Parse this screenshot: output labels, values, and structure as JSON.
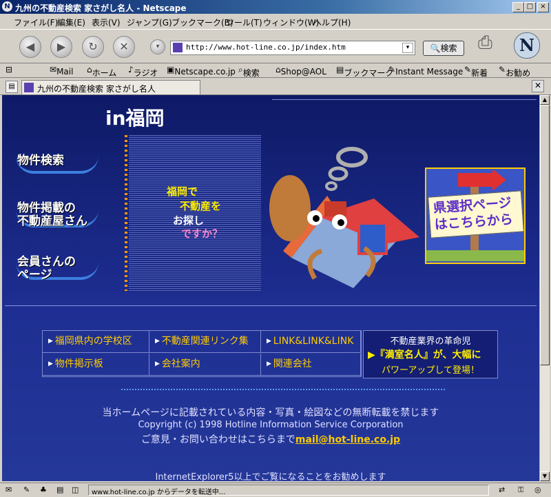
{
  "window": {
    "title": "九州の不動産検索 家さがし名人 - Netscape",
    "minimize": "_",
    "maximize": "□",
    "close": "×"
  },
  "menu": [
    "ファイル(F)",
    "編集(E)",
    "表示(V)",
    "ジャンプ(G)",
    "ブックマーク(B)",
    "ツール(T)",
    "ウィンドウ(W)",
    "ヘルプ(H)"
  ],
  "nav": {
    "url": "http://www.hot-line.co.jp/index.htm",
    "search_label": "検索"
  },
  "personal_toolbar": [
    "Mail",
    "ホーム",
    "ラジオ",
    "Netscape.co.jp",
    "検索",
    "Shop@AOL",
    "ブックマーク",
    "Instant Message",
    "新着",
    "お勧め"
  ],
  "tab": {
    "label": "九州の不動産検索 家さがし名人"
  },
  "page": {
    "heading": "in福岡",
    "left_menu": [
      "物件検索",
      "物件掲載の\n不動産屋さん",
      "会員さんの\nページ"
    ],
    "slogan": [
      "福岡で",
      "不動産を",
      "お探し",
      "ですか？"
    ],
    "sign": "県選択ページはこちらから",
    "links_row1": [
      "福岡県内の学校区",
      "不動産関連リンク集",
      "LINK&LINK&LINK"
    ],
    "links_row2": [
      "物件掲示板",
      "会社案内",
      "関連会社"
    ],
    "promo": {
      "line1": "不動産業界の革命児",
      "line2": "『満室名人』が、大幅に",
      "line3": "パワーアップして登場！"
    },
    "footer": {
      "notice": "当ホームページに記載されている内容・写真・絵図などの無断転載を禁じます",
      "copyright": "Copyright (c) 1998 Hotline Information Service Corporation",
      "contact": "ご意見・お問い合わせはこちらまで",
      "email": "mail@hot-line.co.jp",
      "recommend": "InternetExplorer5以上でご覧になることをお勧めします"
    }
  },
  "status": {
    "text": "www.hot-line.co.jp からデータを転送中..."
  },
  "colors": {
    "page_bg": "#1a2a86",
    "link_text": "#ffcc00",
    "accent": "#ffee00"
  }
}
